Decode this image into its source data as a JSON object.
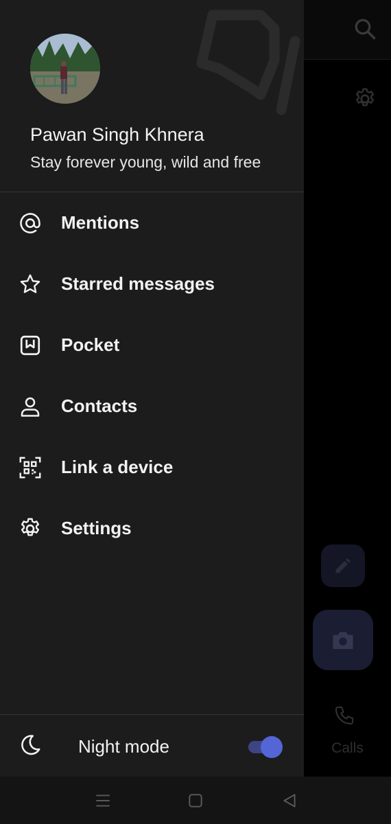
{
  "profile": {
    "name": "Pawan Singh Khnera",
    "status": "Stay forever young, wild and free"
  },
  "menu": {
    "items": [
      {
        "label": "Mentions",
        "icon": "at-icon"
      },
      {
        "label": "Starred messages",
        "icon": "star-icon"
      },
      {
        "label": "Pocket",
        "icon": "pocket-icon"
      },
      {
        "label": "Contacts",
        "icon": "person-icon"
      },
      {
        "label": "Link a device",
        "icon": "qr-code-icon"
      },
      {
        "label": "Settings",
        "icon": "gear-icon"
      }
    ]
  },
  "night_mode": {
    "label": "Night mode",
    "enabled": true,
    "accent_color": "#5465d6"
  },
  "background": {
    "calls_label": "Calls"
  }
}
